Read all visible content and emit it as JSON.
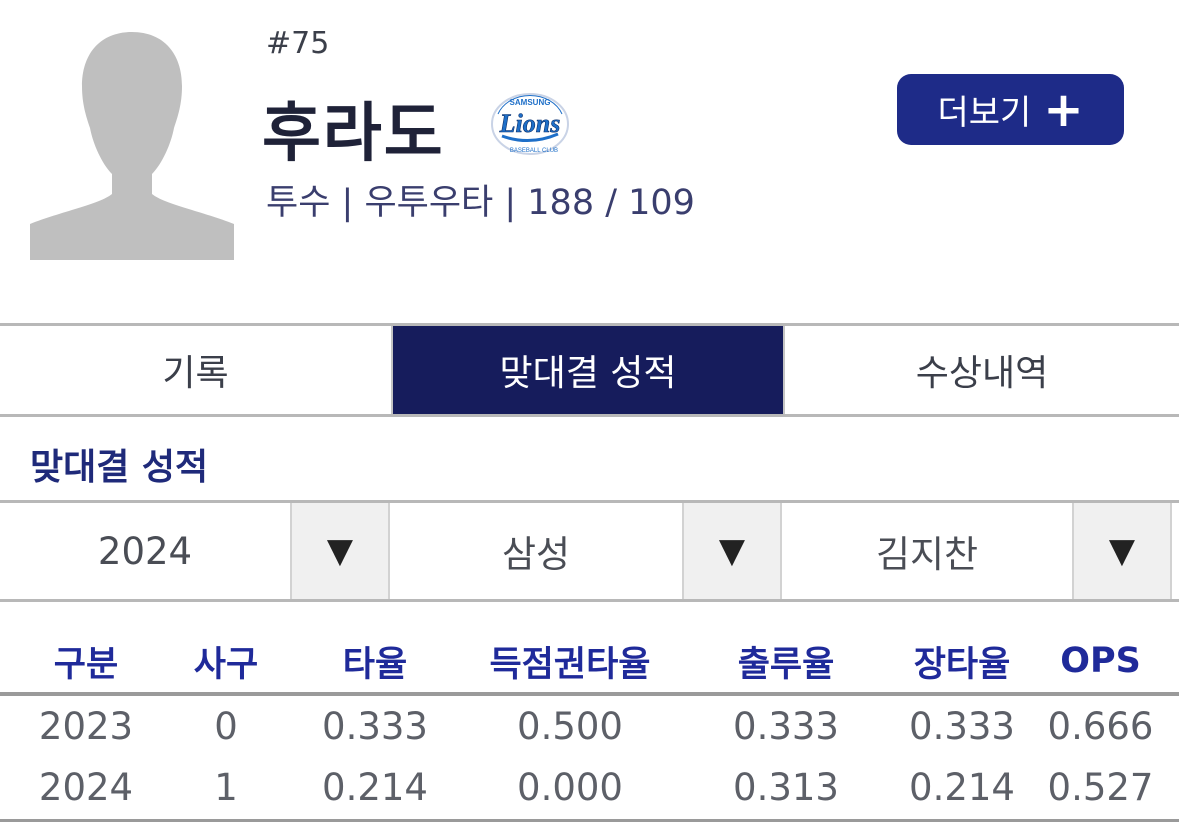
{
  "player": {
    "number": "#75",
    "name": "후라도",
    "meta": "투수 | 우투우타 | 188 / 109",
    "team_logo": {
      "text": "Lions",
      "top_text": "SAMSUNG",
      "bottom_text": "BASEBALL CLUB",
      "color": "#1e6fc8"
    }
  },
  "more_button": {
    "label": "더보기",
    "plus": "+"
  },
  "tabs": [
    {
      "label": "기록",
      "active": false
    },
    {
      "label": "맞대결 성적",
      "active": true
    },
    {
      "label": "수상내역",
      "active": false
    }
  ],
  "section": {
    "title": "맞대결 성적"
  },
  "filters": {
    "year": "2024",
    "team": "삼성",
    "opponent": "김지찬",
    "arrow": "▼"
  },
  "table": {
    "headers": [
      "구분",
      "사구",
      "타율",
      "득점권타율",
      "출루율",
      "장타율",
      "OPS"
    ],
    "rows": [
      [
        "2023",
        "0",
        "0.333",
        "0.500",
        "0.333",
        "0.333",
        "0.666"
      ],
      [
        "2024",
        "1",
        "0.214",
        "0.000",
        "0.313",
        "0.214",
        "0.527"
      ]
    ]
  },
  "colors": {
    "accent_navy": "#1e2b88",
    "tab_active": "#161c5c",
    "header_text": "#1f2a9a"
  }
}
